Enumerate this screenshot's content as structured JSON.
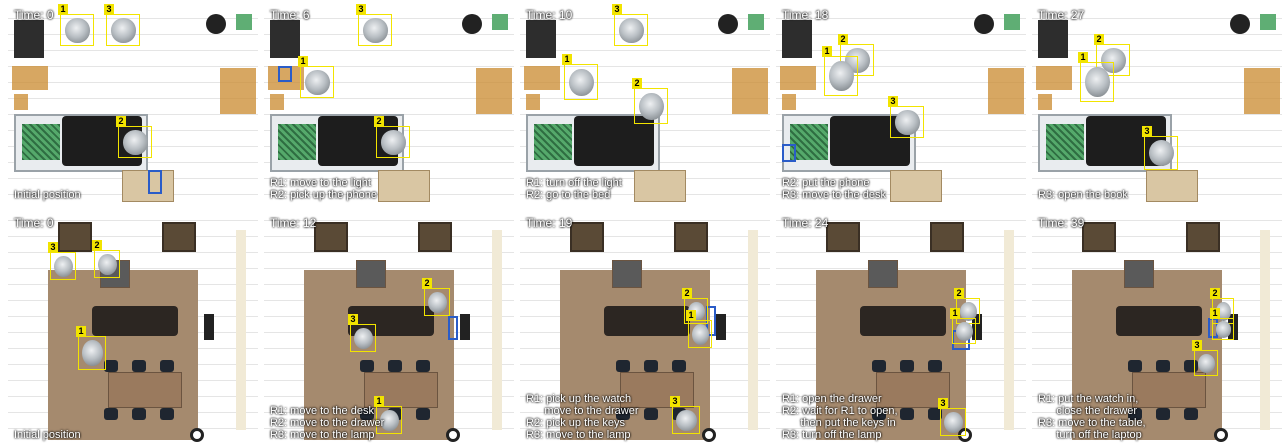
{
  "colors": {
    "highlight": "#f2e400",
    "target": "#2a5cc8",
    "text": "#ffffff"
  },
  "row_bedroom": [
    {
      "time": "Time: 0",
      "caption": [
        "Initial position"
      ]
    },
    {
      "time": "Time: 6",
      "caption": [
        "R1: move to the light",
        "R2: pick up the phone"
      ]
    },
    {
      "time": "Time: 10",
      "caption": [
        "R1: turn off the light",
        "R2: go to the bed"
      ]
    },
    {
      "time": "Time: 18",
      "caption": [
        "R2: put the phone",
        "R3: move to the desk"
      ]
    },
    {
      "time": "Time: 27",
      "caption": [
        "R3: open the book"
      ]
    }
  ],
  "row_living": [
    {
      "time": "Time: 0",
      "caption": [
        "Initial position"
      ]
    },
    {
      "time": "Time: 12",
      "caption": [
        "R1: move to the desk",
        "R2: move to the drawer",
        "R3: move to the lamp"
      ]
    },
    {
      "time": "Time: 19",
      "caption": [
        "R1: pick up the watch",
        "      move to the drawer",
        "R2: pick up the keys",
        "R3: move to the lamp"
      ]
    },
    {
      "time": "Time: 24",
      "caption": [
        "R1: open the drawer",
        "R2: wait for R1 to open,",
        "      then put the keys in",
        "R3: turn off the lamp"
      ]
    },
    {
      "time": "Time: 39",
      "caption": [
        "R1: put the watch in,",
        "      close the drawer",
        "R3: move to the table,",
        "      turn off the laptop"
      ]
    }
  ],
  "robot_labels": [
    "1",
    "2",
    "3"
  ]
}
